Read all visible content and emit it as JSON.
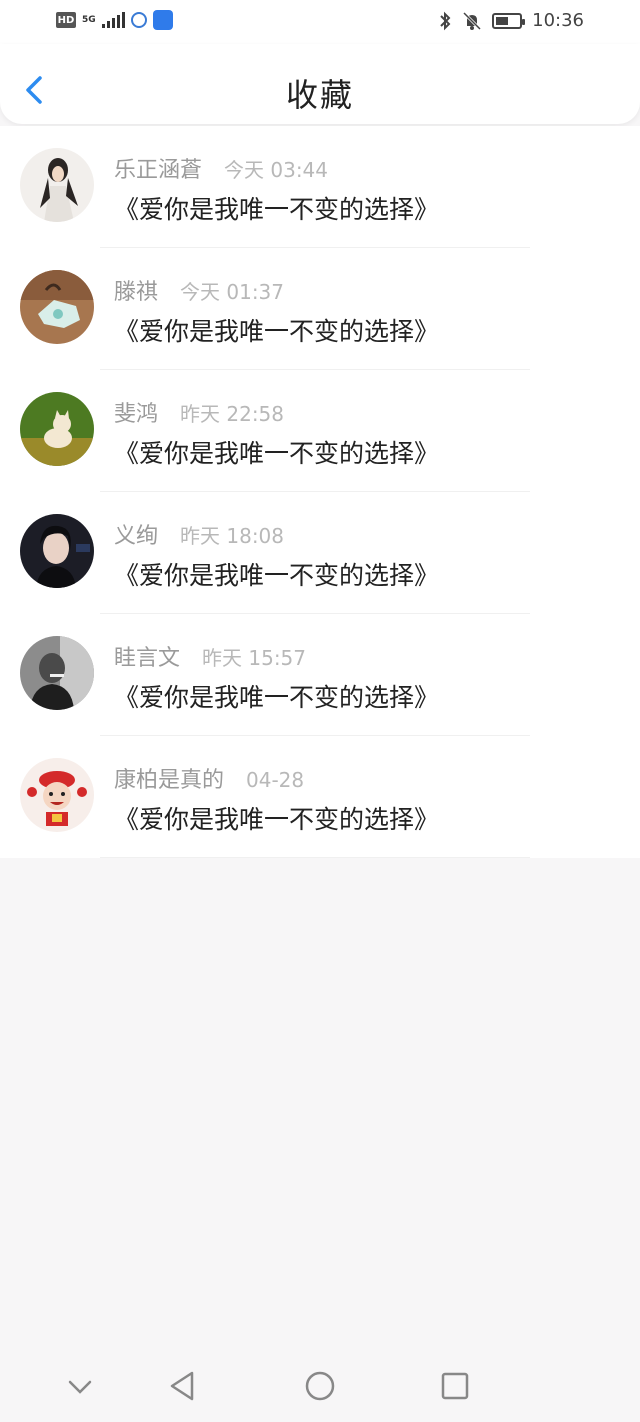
{
  "status_bar": {
    "hd": "HD",
    "network": "5G",
    "time": "10:36",
    "icons": [
      "hd-icon",
      "signal-icon",
      "iflytek-icon",
      "app-store-icon",
      "bluetooth-icon",
      "mute-bell-icon",
      "battery-icon"
    ]
  },
  "header": {
    "title": "收藏",
    "back_icon": "chevron-left-icon",
    "accent": "#2d8cf0"
  },
  "favorites": [
    {
      "name": "乐正涵蒼",
      "time": "今天 03:44",
      "message": "《爱你是我唯一不变的选择》",
      "avatar_color": "#e8e2dc"
    },
    {
      "name": "滕祺",
      "time": "今天 01:37",
      "message": "《爱你是我唯一不变的选择》",
      "avatar_color": "#9a6b4b"
    },
    {
      "name": "斐鸿",
      "time": "昨天 22:58",
      "message": "《爱你是我唯一不变的选择》",
      "avatar_color": "#5d8a2a"
    },
    {
      "name": "义绚",
      "time": "昨天 18:08",
      "message": "《爱你是我唯一不变的选择》",
      "avatar_color": "#1c1c24"
    },
    {
      "name": "眭言文",
      "time": "昨天 15:57",
      "message": "《爱你是我唯一不变的选择》",
      "avatar_color": "#555555"
    },
    {
      "name": "康柏是真的",
      "time": "04-28",
      "message": "《爱你是我唯一不变的选择》",
      "avatar_color": "#f4e6e0"
    }
  ],
  "nav_bar": {
    "icons": [
      "collapse-icon",
      "back-triangle-icon",
      "home-circle-icon",
      "recents-square-icon"
    ]
  }
}
